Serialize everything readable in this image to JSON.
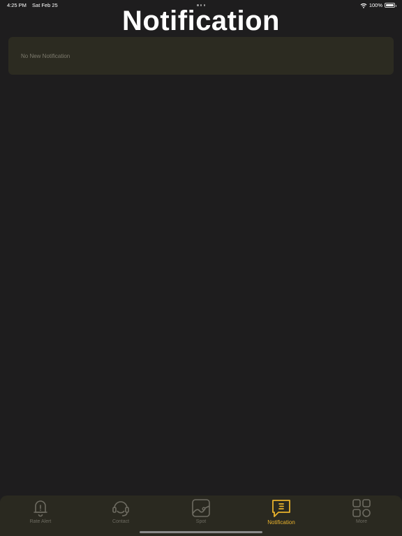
{
  "status_bar": {
    "time": "4:25 PM",
    "date": "Sat Feb 25",
    "battery": "100%"
  },
  "header": {
    "title": "Notification"
  },
  "main": {
    "empty_message": "No New Notification"
  },
  "tab_bar": {
    "active_color": "#e9b22c",
    "inactive_color": "#6e6c62",
    "tabs": [
      {
        "label": "Rate Alert",
        "icon": "bell-icon",
        "active": false
      },
      {
        "label": "Contact",
        "icon": "headset-icon",
        "active": false
      },
      {
        "label": "Spot",
        "icon": "chart-icon",
        "active": false
      },
      {
        "label": "Notification",
        "icon": "message-icon",
        "active": true
      },
      {
        "label": "More",
        "icon": "grid-icon",
        "active": false
      }
    ]
  }
}
